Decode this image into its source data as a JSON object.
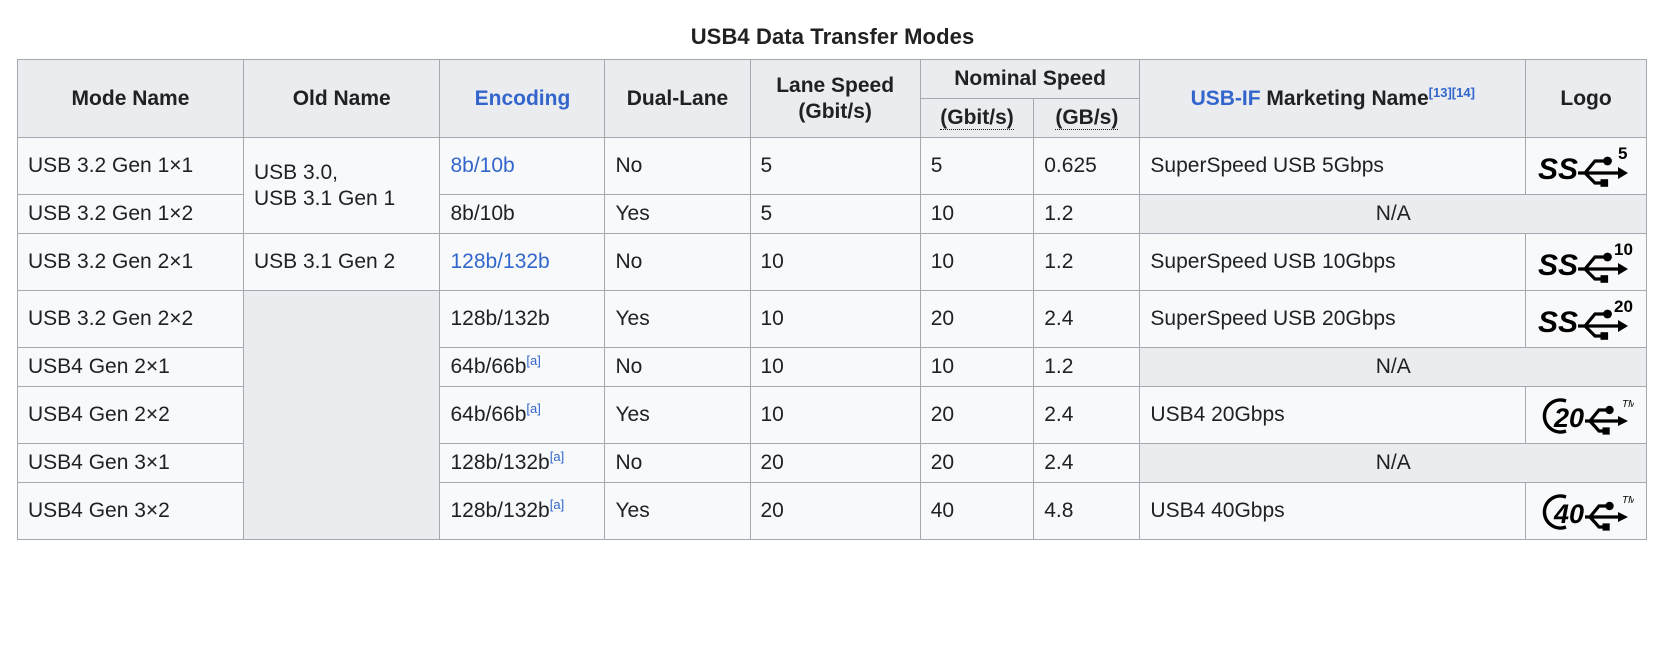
{
  "caption": "USB4 Data Transfer Modes",
  "header": {
    "mode_name": "Mode Name",
    "old_name": "Old Name",
    "encoding": "Encoding",
    "dual_lane": "Dual-Lane",
    "lane_speed_line1": "Lane Speed",
    "lane_speed_line2": "(Gbit/s)",
    "nominal_speed": "Nominal Speed",
    "nominal_gbit": "(Gbit/s)",
    "nominal_gb": "(GB/s)",
    "marketing_name_link": "USB-IF",
    "marketing_name_rest": " Marketing Name",
    "marketing_ref_1": "[13]",
    "marketing_ref_2": "[14]",
    "logo": "Logo"
  },
  "colors": {
    "link": "#3366cc",
    "header_bg": "#eaecf0",
    "cell_bg": "#f8f9fa",
    "border": "#a2a9b1",
    "text": "#202122"
  },
  "old_name_groups": {
    "group1": "USB 3.0,\nUSB 3.1 Gen 1",
    "group1_line1": "USB 3.0,",
    "group1_line2": "USB 3.1 Gen 1",
    "group2": "USB 3.1 Gen 2",
    "group3": ""
  },
  "na_label": "N/A",
  "footnote_marker": "[a]",
  "rows": [
    {
      "mode_name": "USB 3.2 Gen 1×1",
      "encoding": "8b/10b",
      "encoding_is_link": true,
      "encoding_footnote": "",
      "dual_lane": "No",
      "lane_speed": "5",
      "nominal_gbit": "5",
      "nominal_gb": "0.625",
      "marketing_name": "SuperSpeed USB 5Gbps",
      "logo_type": "superspeed",
      "logo_number": "5"
    },
    {
      "mode_name": "USB 3.2 Gen 1×2",
      "encoding": "8b/10b",
      "encoding_is_link": false,
      "encoding_footnote": "",
      "dual_lane": "Yes",
      "lane_speed": "5",
      "nominal_gbit": "10",
      "nominal_gb": "1.2",
      "marketing_name": "N/A",
      "logo_type": "none",
      "logo_number": ""
    },
    {
      "mode_name": "USB 3.2 Gen 2×1",
      "encoding": "128b/132b",
      "encoding_is_link": true,
      "encoding_footnote": "",
      "dual_lane": "No",
      "lane_speed": "10",
      "nominal_gbit": "10",
      "nominal_gb": "1.2",
      "marketing_name": "SuperSpeed USB 10Gbps",
      "logo_type": "superspeed",
      "logo_number": "10"
    },
    {
      "mode_name": "USB 3.2 Gen 2×2",
      "encoding": "128b/132b",
      "encoding_is_link": false,
      "encoding_footnote": "",
      "dual_lane": "Yes",
      "lane_speed": "10",
      "nominal_gbit": "20",
      "nominal_gb": "2.4",
      "marketing_name": "SuperSpeed USB 20Gbps",
      "logo_type": "superspeed",
      "logo_number": "20"
    },
    {
      "mode_name": "USB4 Gen 2×1",
      "encoding": "64b/66b",
      "encoding_is_link": false,
      "encoding_footnote": "[a]",
      "dual_lane": "No",
      "lane_speed": "10",
      "nominal_gbit": "10",
      "nominal_gb": "1.2",
      "marketing_name": "N/A",
      "logo_type": "none",
      "logo_number": ""
    },
    {
      "mode_name": "USB4 Gen 2×2",
      "encoding": "64b/66b",
      "encoding_is_link": false,
      "encoding_footnote": "[a]",
      "dual_lane": "Yes",
      "lane_speed": "10",
      "nominal_gbit": "20",
      "nominal_gb": "2.4",
      "marketing_name": "USB4 20Gbps",
      "logo_type": "usb4",
      "logo_number": "20"
    },
    {
      "mode_name": "USB4 Gen 3×1",
      "encoding": "128b/132b",
      "encoding_is_link": false,
      "encoding_footnote": "[a]",
      "dual_lane": "No",
      "lane_speed": "20",
      "nominal_gbit": "20",
      "nominal_gb": "2.4",
      "marketing_name": "N/A",
      "logo_type": "none",
      "logo_number": ""
    },
    {
      "mode_name": "USB4 Gen 3×2",
      "encoding": "128b/132b",
      "encoding_is_link": false,
      "encoding_footnote": "[a]",
      "dual_lane": "Yes",
      "lane_speed": "20",
      "nominal_gbit": "40",
      "nominal_gb": "4.8",
      "marketing_name": "USB4 40Gbps",
      "logo_type": "usb4",
      "logo_number": "40"
    }
  ]
}
